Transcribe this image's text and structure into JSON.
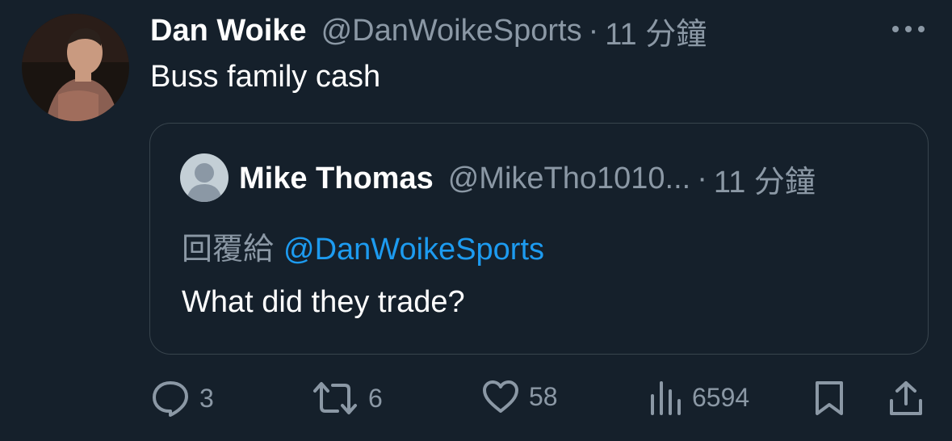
{
  "tweet": {
    "author_name": "Dan Woike",
    "author_handle": "@DanWoikeSports",
    "separator": "·",
    "time": "11 分鐘",
    "text": "Buss family cash"
  },
  "quote": {
    "author_name": "Mike Thomas",
    "author_handle": "@MikeTho1010...",
    "separator": "·",
    "time": "11 分鐘",
    "reply_prefix": "回覆給",
    "reply_mention": "@DanWoikeSports",
    "text": "What did they trade?"
  },
  "actions": {
    "replies": "3",
    "retweets": "6",
    "likes": "58",
    "views": "6594"
  },
  "icons": {
    "more": "more-dots-icon",
    "reply": "reply-icon",
    "retweet": "retweet-icon",
    "like": "heart-icon",
    "views": "views-icon",
    "bookmark": "bookmark-icon",
    "share": "share-icon"
  },
  "colors": {
    "background": "#15202b",
    "muted": "#8b98a5",
    "link": "#1d9bf0",
    "border": "#38444d"
  }
}
